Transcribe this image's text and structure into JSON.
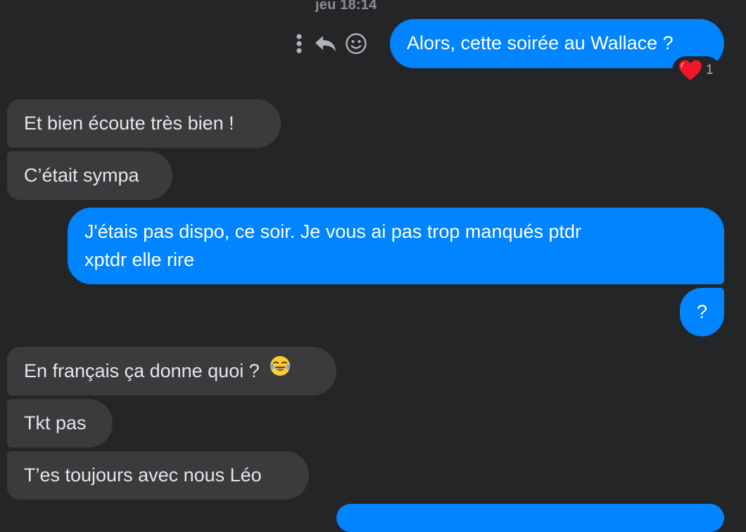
{
  "conversation": {
    "timestamp": "jeu 18:14",
    "actions": {
      "more_icon": "more-vertical-icon",
      "reply_icon": "reply-icon",
      "react_icon": "smiley-icon"
    },
    "messages": [
      {
        "from": "me",
        "text": "Alors, cette soirée au Wallace ?"
      },
      {
        "from": "them",
        "text": "Et bien écoute très bien !"
      },
      {
        "from": "them",
        "text": "C’était sympa"
      },
      {
        "from": "me",
        "line1": "J'étais pas dispo, ce soir. Je vous ai pas trop manqués ptdr",
        "line2": "xptdr elle rire"
      },
      {
        "from": "me",
        "text": "?"
      },
      {
        "from": "them",
        "text": "En français ça donne quoi ?",
        "emoji": "face-with-tears-of-joy"
      },
      {
        "from": "them",
        "text": "Tkt pas"
      },
      {
        "from": "them",
        "text": "T’es toujours avec nous Léo"
      }
    ],
    "reaction": {
      "emoji": "red-heart",
      "count": "1"
    }
  },
  "colors": {
    "background": "#242526",
    "outgoing_bubble": "#0084ff",
    "incoming_bubble": "#3a3b3c",
    "incoming_text": "#e4e6eb",
    "muted": "#8a8d91"
  }
}
